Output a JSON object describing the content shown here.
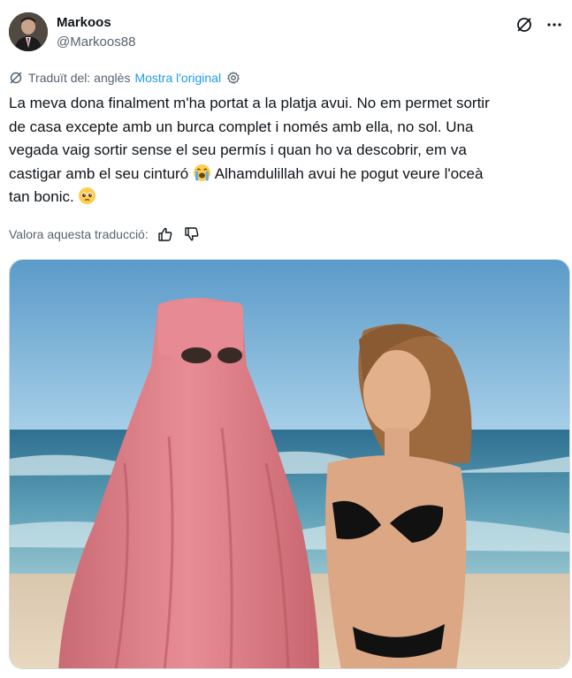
{
  "author": {
    "display_name": "Markoos",
    "handle": "@Markoos88",
    "avatar_icon": "avatar-photo"
  },
  "header_icons": [
    "grok-icon",
    "more-icon"
  ],
  "more_label": "···",
  "translation": {
    "label": "Traduït del: anglès",
    "show_original": "Mostra l'original",
    "icon": "translate-icon",
    "settings_icon": "gear-icon"
  },
  "tweet": {
    "line_1": "La meva dona finalment m'ha portat a la platja avui. No em permet sortir",
    "line_2": "de casa excepte amb un burca complet i només amb ella, no sol. Una",
    "line_3": "vegada vaig sortir sense el seu permís i quan ho va descobrir, em va",
    "line_4a": "castigar amb el seu cinturó",
    "line_4b": "Alhamdulillah avui he pogut veure l'oceà",
    "line_5": "tan bonic.",
    "emoji_1": "crying-face-emoji",
    "emoji_2": "pleading-face-emoji"
  },
  "rate": {
    "label": "Valora aquesta traducció:",
    "thumbs_up_icon": "thumbs-up-icon",
    "thumbs_down_icon": "thumbs-down-icon"
  },
  "media": {
    "description_icon": "beach-photo"
  },
  "colors": {
    "text": "#0f1419",
    "secondary": "#536471",
    "link": "#1d9bf0",
    "border": "#cfd9de"
  }
}
